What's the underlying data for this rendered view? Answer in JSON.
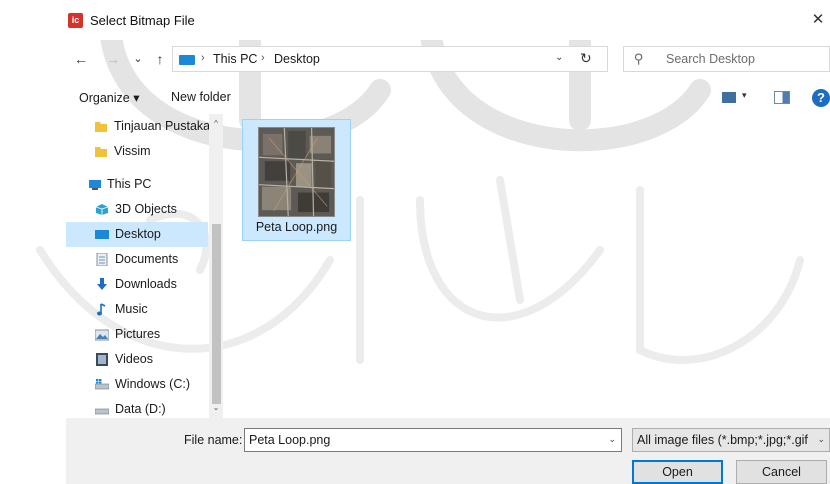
{
  "window": {
    "title": "Select Bitmap File",
    "app_icon_text": "ic",
    "close_glyph": "✕"
  },
  "nav": {
    "back_glyph": "←",
    "forward_glyph": "→",
    "recent_glyph": "⌄",
    "up_glyph": "↑",
    "address": [
      "This PC",
      "Desktop"
    ],
    "crumb_separator": "›",
    "address_dropdown_glyph": "⌄",
    "refresh_glyph": "↻",
    "search_placeholder": "Search Desktop",
    "search_glyph": "⚲"
  },
  "toolbar": {
    "organize_label": "Organize ▾",
    "new_folder_label": "New folder",
    "view_dropdown_glyph": "▾",
    "help_glyph": "?"
  },
  "sidebar": {
    "items": [
      {
        "label": "Tinjauan Pustaka",
        "icon": "folder-icon"
      },
      {
        "label": "Vissim",
        "icon": "folder-icon"
      },
      {
        "label": "This PC",
        "icon": "pc-icon"
      },
      {
        "label": "3D Objects",
        "icon": "cube-icon"
      },
      {
        "label": "Desktop",
        "icon": "desktop-icon",
        "selected": true
      },
      {
        "label": "Documents",
        "icon": "document-icon"
      },
      {
        "label": "Downloads",
        "icon": "download-icon"
      },
      {
        "label": "Music",
        "icon": "music-icon"
      },
      {
        "label": "Pictures",
        "icon": "pictures-icon"
      },
      {
        "label": "Videos",
        "icon": "video-icon"
      },
      {
        "label": "Windows (C:)",
        "icon": "drive-icon"
      },
      {
        "label": "Data (D:)",
        "icon": "drive-icon"
      }
    ],
    "scroll_up_glyph": "^",
    "scroll_down_glyph": "⌄"
  },
  "files": [
    {
      "name": "Peta Loop.png",
      "selected": true
    }
  ],
  "footer": {
    "file_name_label": "File name:",
    "file_name_value": "Peta Loop.png",
    "file_type_value": "All image files (*.bmp;*.jpg;*.gif",
    "dropdown_glyph": "⌄",
    "open_label": "Open",
    "cancel_label": "Cancel"
  },
  "colors": {
    "selection": "#cce8ff",
    "accent": "#0078d7",
    "app_icon": "#d6322a"
  }
}
